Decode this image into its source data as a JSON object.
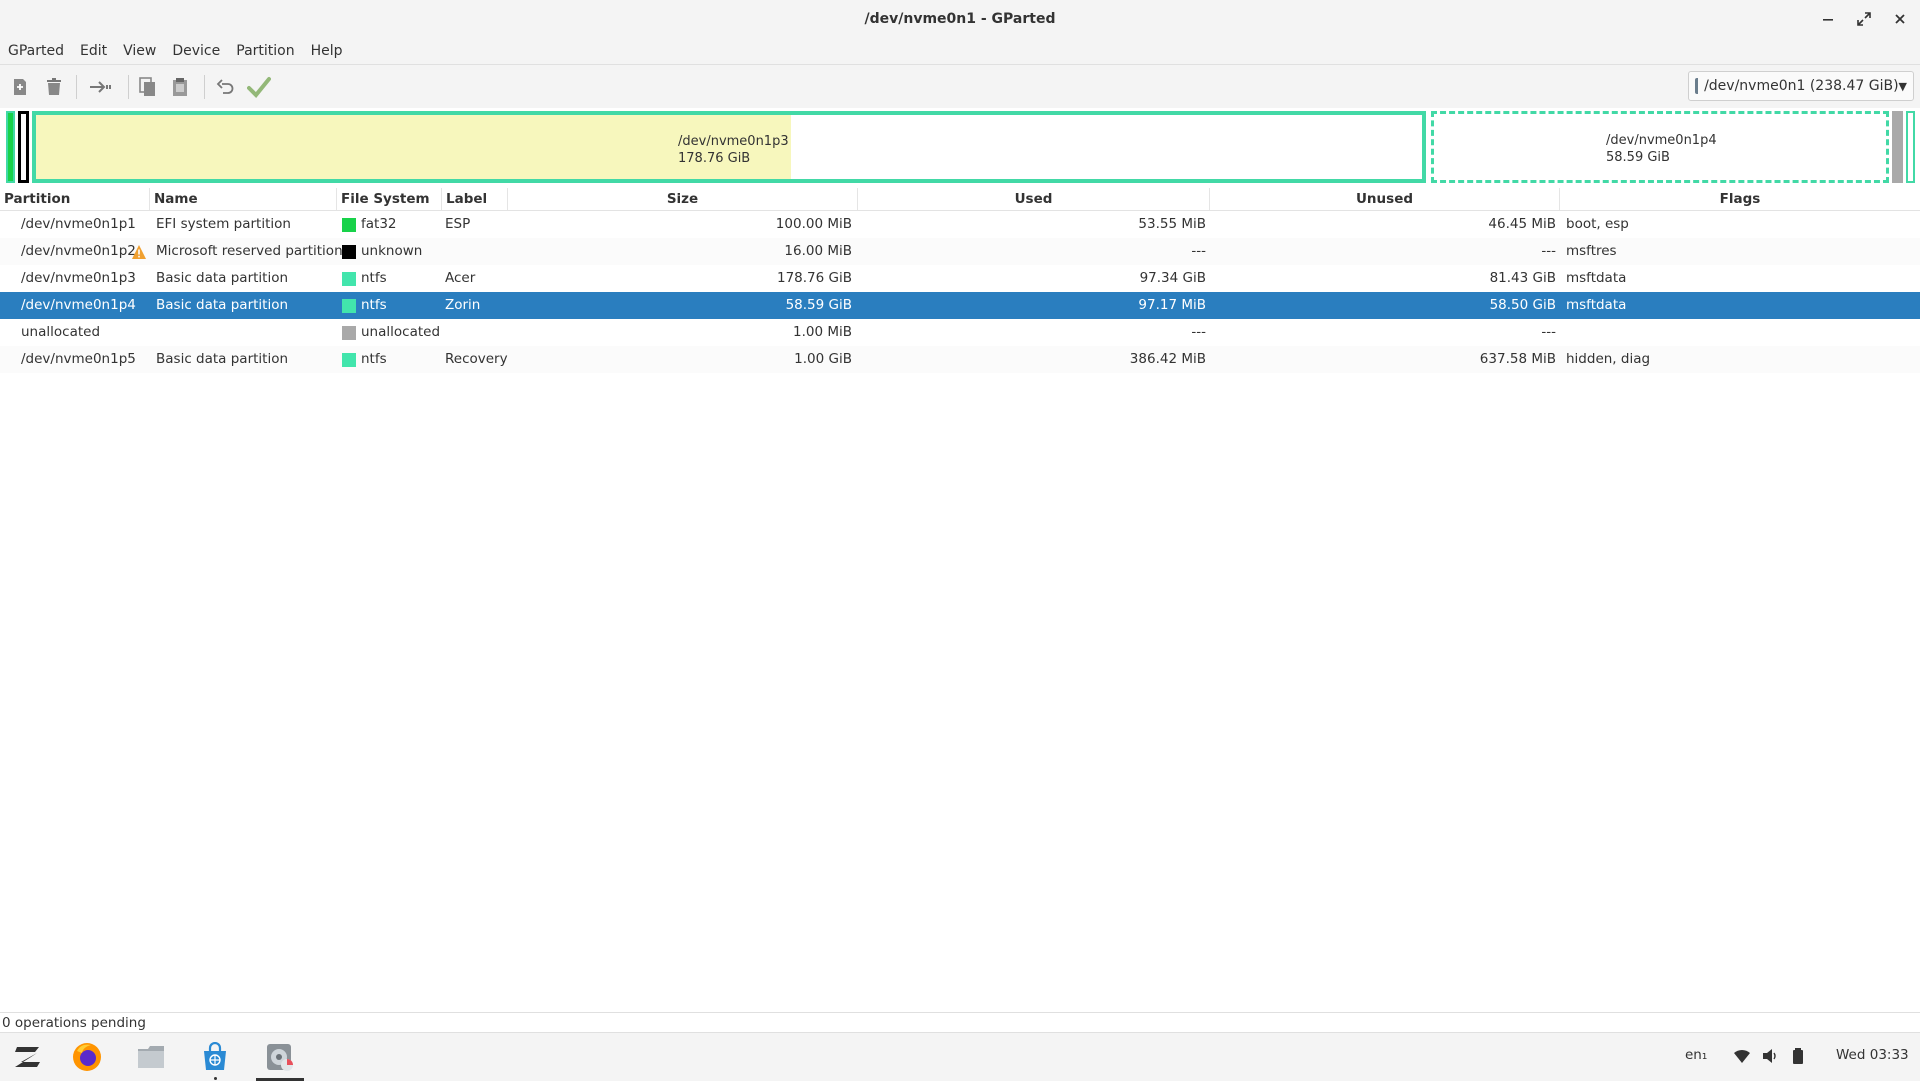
{
  "window": {
    "title": "/dev/nvme0n1 - GParted"
  },
  "menu": [
    "GParted",
    "Edit",
    "View",
    "Device",
    "Partition",
    "Help"
  ],
  "toolbar": {
    "icons": [
      "new-icon",
      "delete-icon",
      "resize-move-icon",
      "copy-icon",
      "paste-icon",
      "undo-icon",
      "apply-icon"
    ],
    "device": "/dev/nvme0n1  (238.47 GiB)"
  },
  "diskmap": {
    "p3": {
      "name": "/dev/nvme0n1p3",
      "size": "178.76 GiB",
      "used_fraction": 0.545
    },
    "p4": {
      "name": "/dev/nvme0n1p4",
      "size": "58.59 GiB"
    }
  },
  "columns": [
    "Partition",
    "Name",
    "File System",
    "Label",
    "Size",
    "Used",
    "Unused",
    "Flags"
  ],
  "rows": [
    {
      "partition": "/dev/nvme0n1p1",
      "name": "EFI system partition",
      "fs": "fat32",
      "fs_color": "#18d24a",
      "label": "ESP",
      "size": "100.00 MiB",
      "used": "53.55 MiB",
      "unused": "46.45 MiB",
      "flags": "boot, esp",
      "warning": false,
      "selected": false
    },
    {
      "partition": "/dev/nvme0n1p2",
      "name": "Microsoft reserved partition",
      "fs": "unknown",
      "fs_color": "#000000",
      "label": "",
      "size": "16.00 MiB",
      "used": "---",
      "unused": "---",
      "flags": "msftres",
      "warning": true,
      "selected": false
    },
    {
      "partition": "/dev/nvme0n1p3",
      "name": "Basic data partition",
      "fs": "ntfs",
      "fs_color": "#42e5ac",
      "label": "Acer",
      "size": "178.76 GiB",
      "used": "97.34 GiB",
      "unused": "81.43 GiB",
      "flags": "msftdata",
      "warning": false,
      "selected": false
    },
    {
      "partition": "/dev/nvme0n1p4",
      "name": "Basic data partition",
      "fs": "ntfs",
      "fs_color": "#42e5ac",
      "label": "Zorin",
      "size": "58.59 GiB",
      "used": "97.17 MiB",
      "unused": "58.50 GiB",
      "flags": "msftdata",
      "warning": false,
      "selected": true
    },
    {
      "partition": "unallocated",
      "name": "",
      "fs": "unallocated",
      "fs_color": "#a9a9a9",
      "label": "",
      "size": "1.00 MiB",
      "used": "---",
      "unused": "---",
      "flags": "",
      "warning": false,
      "selected": false
    },
    {
      "partition": "/dev/nvme0n1p5",
      "name": "Basic data partition",
      "fs": "ntfs",
      "fs_color": "#42e5ac",
      "label": "Recovery",
      "size": "1.00 GiB",
      "used": "386.42 MiB",
      "unused": "637.58 MiB",
      "flags": "hidden, diag",
      "warning": false,
      "selected": false
    }
  ],
  "status": "0 operations pending",
  "taskbar": {
    "apps": [
      "zorin-menu-icon",
      "firefox-icon",
      "files-icon",
      "software-store-icon",
      "gparted-icon"
    ],
    "keyboard": "en₁",
    "clock": "Wed 03:33"
  },
  "colors": {
    "selection": "#2a7ebf",
    "partition_border": "#42d9a6",
    "used_fill": "#f7f7bd"
  }
}
